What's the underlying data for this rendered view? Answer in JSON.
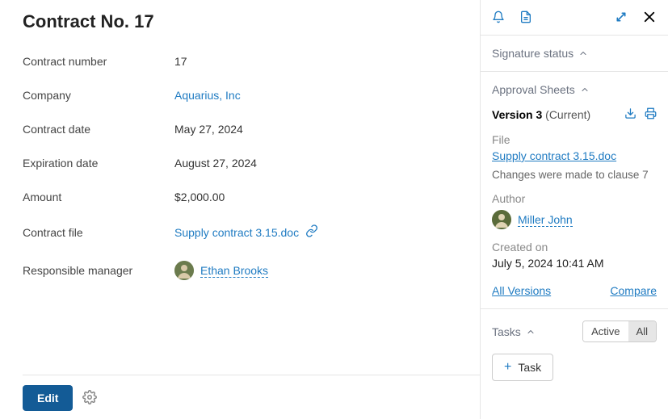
{
  "header": {
    "title": "Contract No. 17"
  },
  "details": {
    "labels": {
      "contract_number": "Contract number",
      "company": "Company",
      "contract_date": "Contract date",
      "expiration_date": "Expiration date",
      "amount": "Amount",
      "contract_file": "Contract file",
      "responsible_manager": "Responsible manager"
    },
    "values": {
      "contract_number": "17",
      "company": "Aquarius, Inc",
      "contract_date": "May 27, 2024",
      "expiration_date": "August 27, 2024",
      "amount": "$2,000.00",
      "contract_file": "Supply contract 3.15.doc",
      "responsible_manager": "Ethan Brooks"
    }
  },
  "footer": {
    "edit_label": "Edit"
  },
  "side": {
    "signature_status": {
      "title": "Signature status"
    },
    "approval_sheets": {
      "title": "Approval Sheets",
      "version_label": "Version 3",
      "current_label": "(Current)",
      "file_label": "File",
      "file_name": "Supply contract 3.15.doc",
      "change_note": "Changes were made to clause 7",
      "author_label": "Author",
      "author_name": "Miller John",
      "created_label": "Created on",
      "created_value": "July 5, 2024 10:41 AM",
      "all_versions_label": "All Versions",
      "compare_label": "Compare"
    },
    "tasks": {
      "title": "Tasks",
      "toggle_active": "Active",
      "toggle_all": "All",
      "add_label": "Task"
    }
  }
}
